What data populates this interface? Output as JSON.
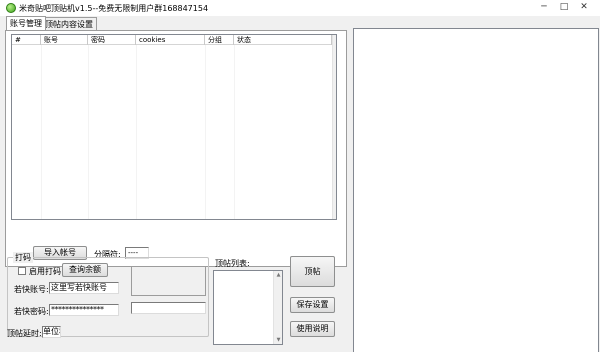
{
  "window": {
    "title": "米奇贴吧顶贴机v1.5--免费无限制用户群168847154",
    "min_glyph": "─",
    "max_glyph": "□",
    "close_glyph": "✕"
  },
  "tabs": [
    {
      "label": "账号管理",
      "active": true
    },
    {
      "label": "顶帖内容设置",
      "active": false
    }
  ],
  "account_table": {
    "columns": [
      "#",
      "账号",
      "密码",
      "cookies",
      "分组",
      "状态"
    ],
    "rows": []
  },
  "import": {
    "button_label": "导入帐号",
    "separator_label": "分隔符:",
    "separator_value": "----"
  },
  "captcha_group": {
    "title": "打码",
    "enable_label": "启用打码",
    "enabled": false,
    "query_button_label": "查询余额",
    "account_label": "若快账号:",
    "account_value": "这里写若快账号",
    "password_label": "若快密码:",
    "password_value": "***************"
  },
  "delay": {
    "label": "顶帖延时:",
    "value": "单位秒"
  },
  "top_list": {
    "label": "顶帖列表:",
    "items": []
  },
  "actions": {
    "top_label": "顶帖",
    "save_label": "保存设置",
    "help_label": "使用说明"
  },
  "icons": {
    "app": "app-green-orb-icon",
    "scroll_up": "▲",
    "scroll_down": "▼"
  }
}
